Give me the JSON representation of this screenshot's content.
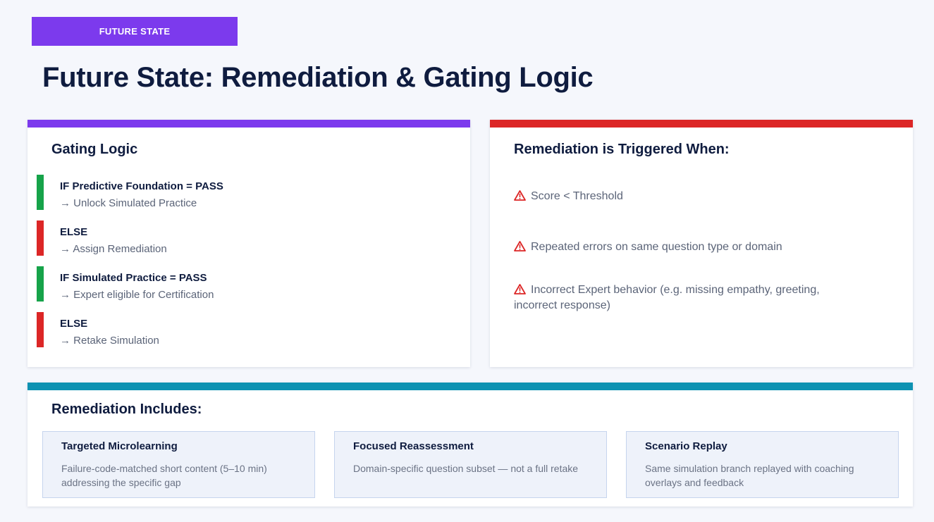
{
  "tag": "FUTURE STATE",
  "title": "Future State: Remediation & Gating Logic",
  "colors": {
    "purple": "#7c3aed",
    "red": "#dc2626",
    "green": "#16a34a",
    "teal": "#0e92b2"
  },
  "gating": {
    "title": "Gating Logic",
    "items": [
      {
        "condition": "IF Predictive Foundation = PASS",
        "result": "→ Unlock Simulated Practice",
        "status": "pass"
      },
      {
        "condition": "ELSE",
        "result": "→ Assign Remediation",
        "status": "fail"
      },
      {
        "condition": "IF Simulated Practice = PASS",
        "result": "→ Expert eligible for Certification",
        "status": "pass"
      },
      {
        "condition": "ELSE",
        "result": "→ Retake Simulation",
        "status": "fail"
      }
    ]
  },
  "remediation_triggers": {
    "title": "Remediation is Triggered When:",
    "icon": "warning-icon",
    "items": [
      "Score < Threshold",
      "Repeated errors on same question type or domain",
      "Incorrect Expert behavior (e.g. missing empathy, greeting, incorrect response)"
    ]
  },
  "remediation_includes": {
    "title": "Remediation Includes:",
    "items": [
      {
        "title": "Targeted Microlearning",
        "description": "Failure-code-matched short content (5–10 min) addressing the specific gap"
      },
      {
        "title": "Focused Reassessment",
        "description": "Domain-specific question subset — not a full retake"
      },
      {
        "title": "Scenario Replay",
        "description": "Same simulation branch replayed with coaching overlays and feedback"
      }
    ]
  }
}
